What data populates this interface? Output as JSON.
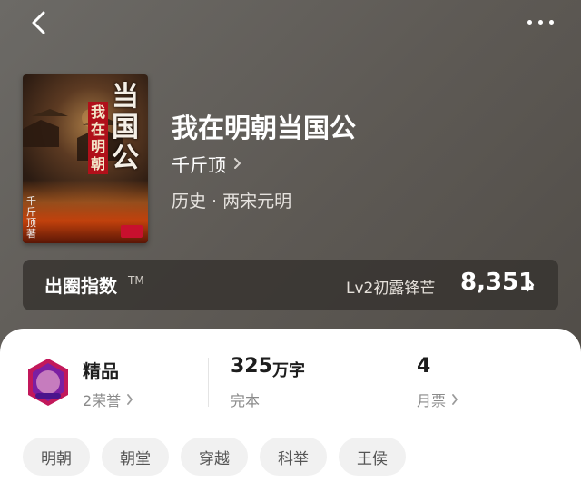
{
  "book": {
    "title": "我在明朝当国公",
    "author": "千斤顶",
    "genre": "历史 · 两宋元明",
    "cover": {
      "title_big": "当国公",
      "title_small": "我在明朝",
      "author_text": "千斤顶著"
    }
  },
  "index": {
    "label": "出圈指数",
    "tm": "TM",
    "level": "Lv2初露锋芒",
    "value": "8,351"
  },
  "stats": {
    "quality": {
      "title": "精品",
      "sub": "2荣誉"
    },
    "words": {
      "value": "325",
      "unit": "万字",
      "sub": "完本"
    },
    "votes": {
      "value": "4",
      "sub": "月票"
    }
  },
  "tags": [
    "明朝",
    "朝堂",
    "穿越",
    "科举",
    "王侯"
  ],
  "colors": {
    "header_bg": "#5f5b56",
    "panel_bg": "#ffffff",
    "tag_bg": "#f1f1f1",
    "badge_red": "#c2185b"
  }
}
